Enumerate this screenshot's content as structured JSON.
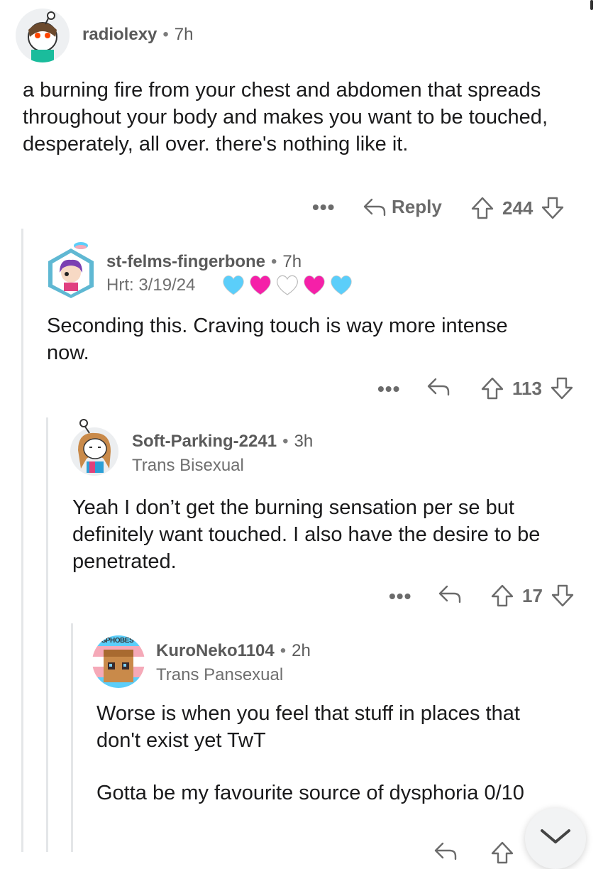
{
  "comments": [
    {
      "username": "radiolexy",
      "time": "7h",
      "flair": "",
      "text": "a burning fire from your chest and abdomen that spreads throughout your body and makes you want to be touched, desperately, all over. there's nothing like it.",
      "reply_label": "Reply",
      "score": "244"
    },
    {
      "username": "st-felms-fingerbone",
      "time": "7h",
      "flair": "Hrt: 3/19/24",
      "flair_hearts": [
        "#5bcefa",
        "#f520a8",
        "#ffffff",
        "#f520a8",
        "#5bcefa"
      ],
      "text": "Seconding this. Craving touch is way more intense now.",
      "score": "113"
    },
    {
      "username": "Soft-Parking-2241",
      "time": "3h",
      "flair": "Trans Bisexual",
      "text": "Yeah I don’t get the burning sensation per se but definitely want touched. I also have the desire to be penetrated.",
      "score": "17"
    },
    {
      "username": "KuroNeko1104",
      "time": "2h",
      "flair": "Trans Pansexual",
      "avatar_text": "NSPHOBES",
      "text1": "Worse is when you feel that stuff in places that don't exist yet TwT",
      "text2": "Gotta be my favourite source of dysphoria 0/10"
    }
  ],
  "separator": "•",
  "more_label": "•••",
  "colors": {
    "accent_blue": "#5bcefa",
    "accent_pink": "#f5a9b8",
    "text": "#1a1a1b",
    "muted": "#6b6b6b"
  }
}
